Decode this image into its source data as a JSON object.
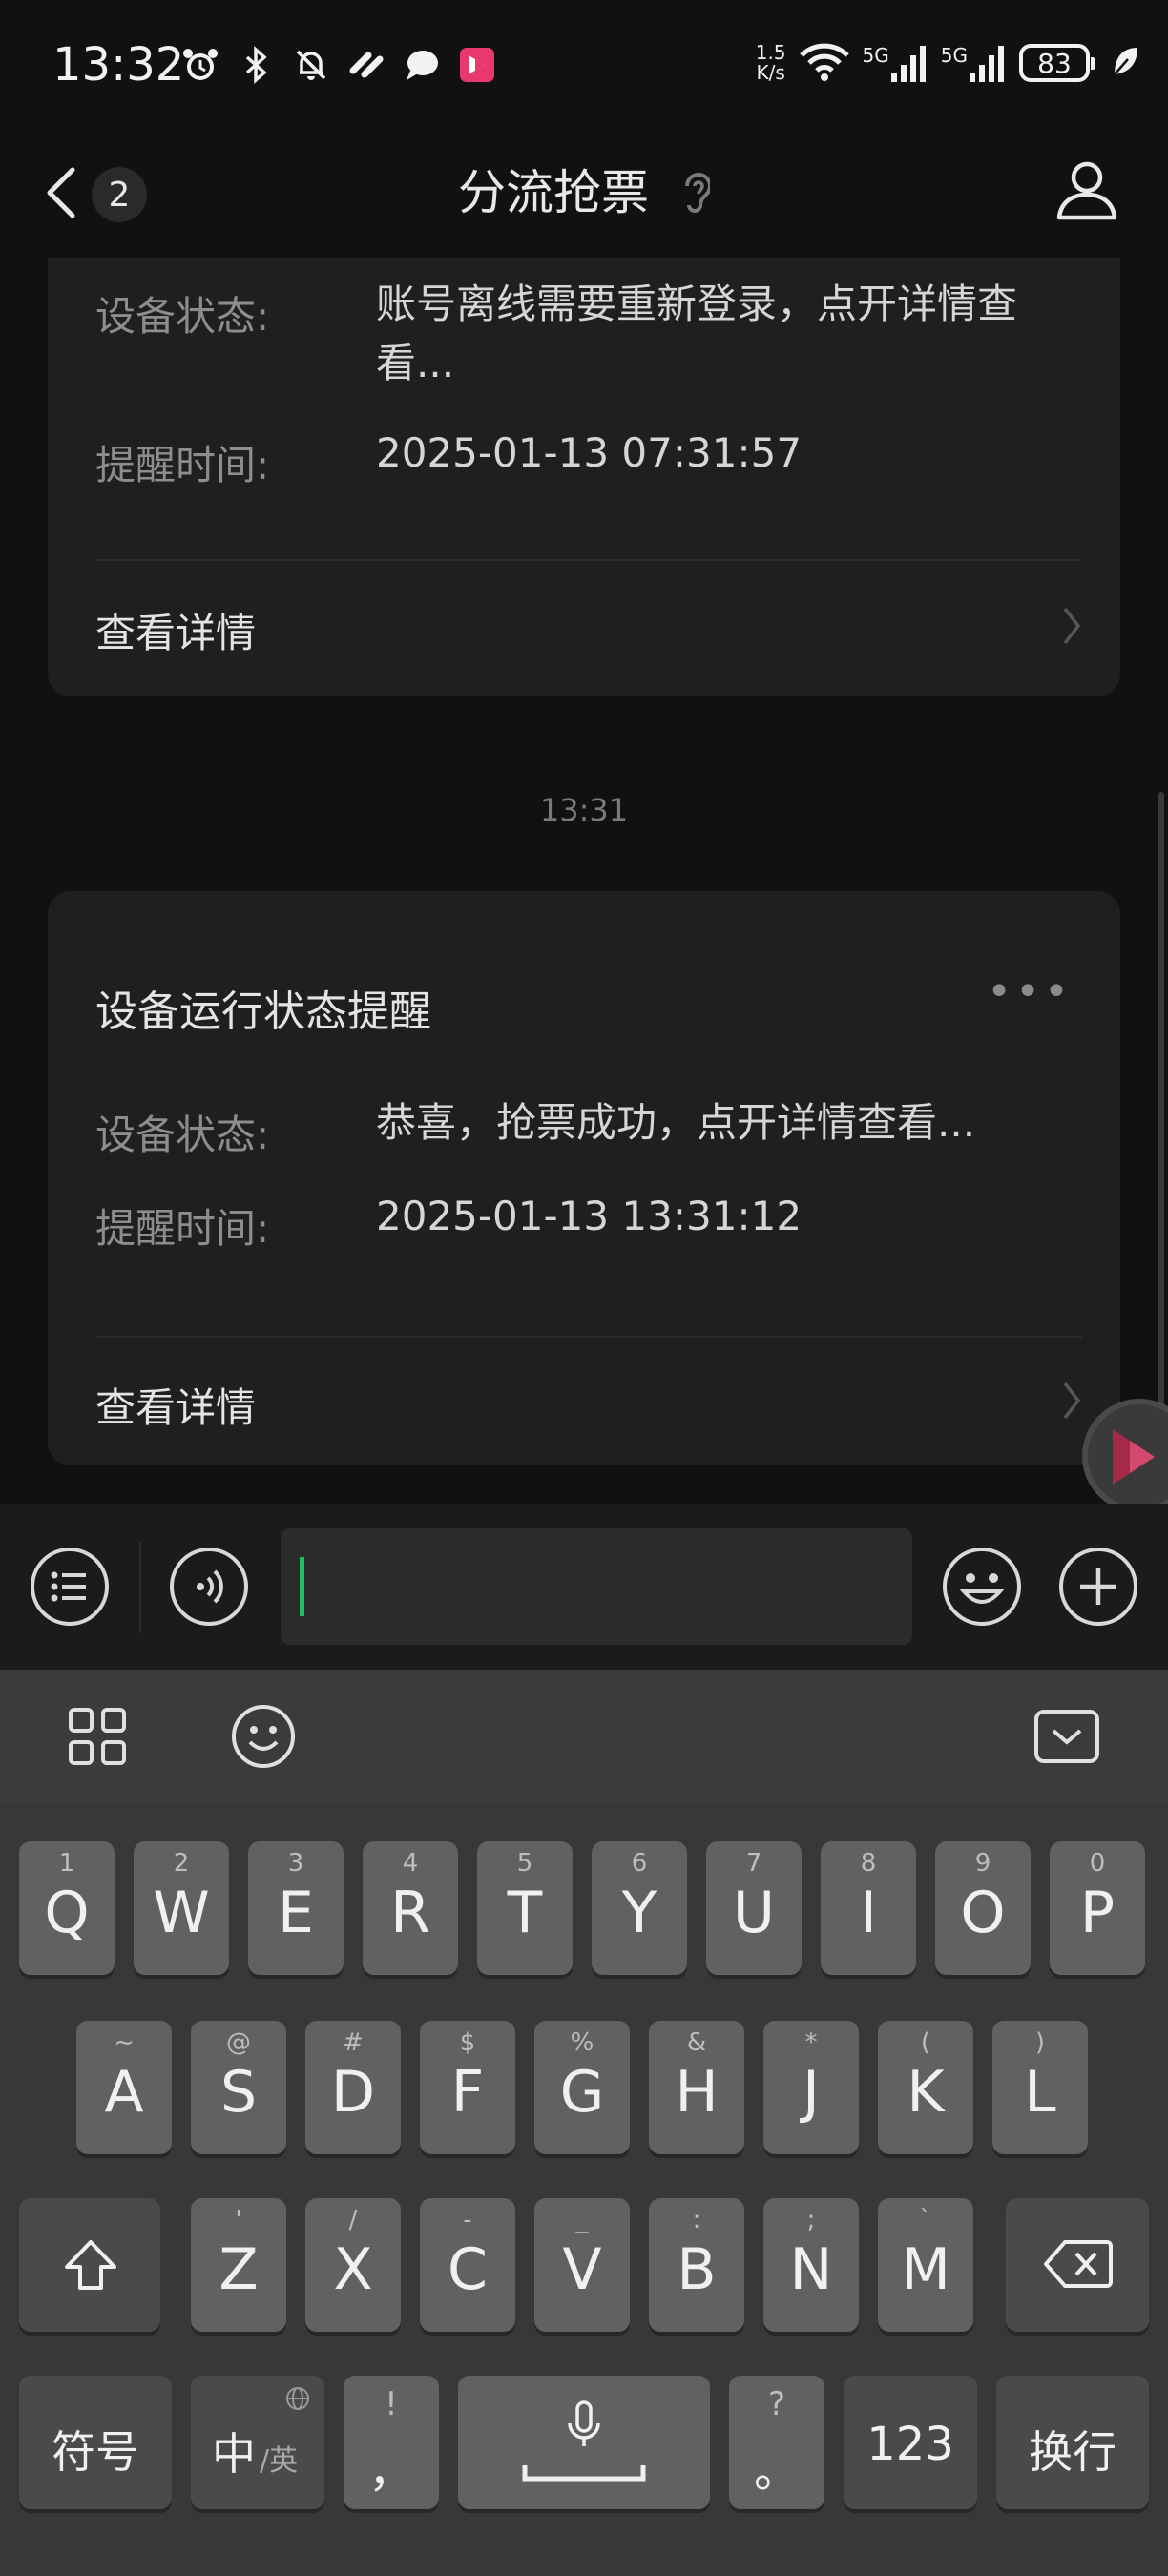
{
  "status_bar": {
    "time": "13:32",
    "net_speed_value": "1.5",
    "net_speed_unit": "K/s",
    "signal_1_label": "5G",
    "signal_2_label": "5G",
    "battery": "83"
  },
  "nav": {
    "unread_count": "2",
    "title": "分流抢票"
  },
  "messages": {
    "card1": {
      "status_label": "设备状态:",
      "status_value": "账号离线需要重新登录，点开详情查看...",
      "time_label": "提醒时间:",
      "time_value": "2025-01-13 07:31:57",
      "detail_link": "查看详情"
    },
    "time_separator": "13:31",
    "card2": {
      "title": "设备运行状态提醒",
      "status_label": "设备状态:",
      "status_value": "恭喜，抢票成功，点开详情查看...",
      "time_label": "提醒时间:",
      "time_value": "2025-01-13 13:31:12",
      "detail_link": "查看详情"
    }
  },
  "accent_color": "#1fbf5f",
  "keyboard": {
    "row1": [
      {
        "k": "Q",
        "h": "1"
      },
      {
        "k": "W",
        "h": "2"
      },
      {
        "k": "E",
        "h": "3"
      },
      {
        "k": "R",
        "h": "4"
      },
      {
        "k": "T",
        "h": "5"
      },
      {
        "k": "Y",
        "h": "6"
      },
      {
        "k": "U",
        "h": "7"
      },
      {
        "k": "I",
        "h": "8"
      },
      {
        "k": "O",
        "h": "9"
      },
      {
        "k": "P",
        "h": "0"
      }
    ],
    "row2": [
      {
        "k": "A",
        "h": "~"
      },
      {
        "k": "S",
        "h": "@"
      },
      {
        "k": "D",
        "h": "#"
      },
      {
        "k": "F",
        "h": "$"
      },
      {
        "k": "G",
        "h": "%"
      },
      {
        "k": "H",
        "h": "&"
      },
      {
        "k": "J",
        "h": "*"
      },
      {
        "k": "K",
        "h": "("
      },
      {
        "k": "L",
        "h": ")"
      }
    ],
    "row3": [
      {
        "k": "Z",
        "h": "'"
      },
      {
        "k": "X",
        "h": "/"
      },
      {
        "k": "C",
        "h": "-"
      },
      {
        "k": "V",
        "h": "_"
      },
      {
        "k": "B",
        "h": ":"
      },
      {
        "k": "N",
        "h": ";"
      },
      {
        "k": "M",
        "h": "`"
      }
    ],
    "symbols_label": "符号",
    "lang_main": "中",
    "lang_sub": "/英",
    "comma_hint": "!",
    "comma": "，",
    "period_hint": "?",
    "period": "。",
    "num_label": "123",
    "enter_label": "换行"
  }
}
